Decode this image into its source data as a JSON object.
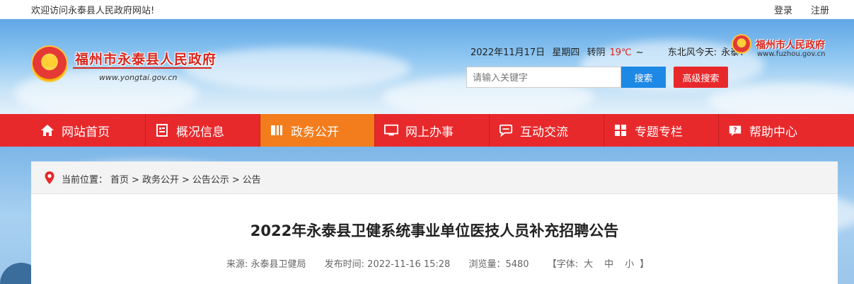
{
  "topbar": {
    "welcome": "欢迎访问永泰县人民政府网站!",
    "login": "登录",
    "register": "注册"
  },
  "header": {
    "site_title": "福州市永泰县人民政府",
    "site_url": "www.yongtai.gov.cn",
    "date": "2022年11月17日",
    "weekday": "星期四",
    "weather": "转阴",
    "temp_high": "19℃",
    "temp_sep": "~",
    "wind": "东北风今天:",
    "city": "永泰：",
    "fz_title": "福州市人民政府",
    "fz_url": "www.fuzhou.gov.cn"
  },
  "search": {
    "placeholder": "请输入关键字",
    "button": "搜索",
    "advanced": "高级搜索"
  },
  "nav": [
    {
      "label": "网站首页",
      "icon": "home-icon"
    },
    {
      "label": "概况信息",
      "icon": "document-icon"
    },
    {
      "label": "政务公开",
      "icon": "book-icon",
      "active": true
    },
    {
      "label": "网上办事",
      "icon": "monitor-icon"
    },
    {
      "label": "互动交流",
      "icon": "chat-icon"
    },
    {
      "label": "专题专栏",
      "icon": "grid-icon"
    },
    {
      "label": "帮助中心",
      "icon": "help-icon"
    }
  ],
  "breadcrumb": {
    "prefix": "当前位置：",
    "items": [
      "首页",
      "政务公开",
      "公告公示",
      "公告"
    ],
    "separator": ">"
  },
  "article": {
    "title": "2022年永泰县卫健系统事业单位医技人员补充招聘公告",
    "source": "来源: 永泰县卫健局",
    "published": "发布时间: 2022-11-16 15:28",
    "views": "浏览量：5480",
    "font_label": "【字体:",
    "font_large": "大",
    "font_medium": "中",
    "font_small": "小",
    "font_close": "】"
  },
  "colors": {
    "nav_red": "#e8292c",
    "nav_active": "#f37d1c",
    "search_blue": "#1e88e5",
    "title_red": "#d7261e"
  }
}
